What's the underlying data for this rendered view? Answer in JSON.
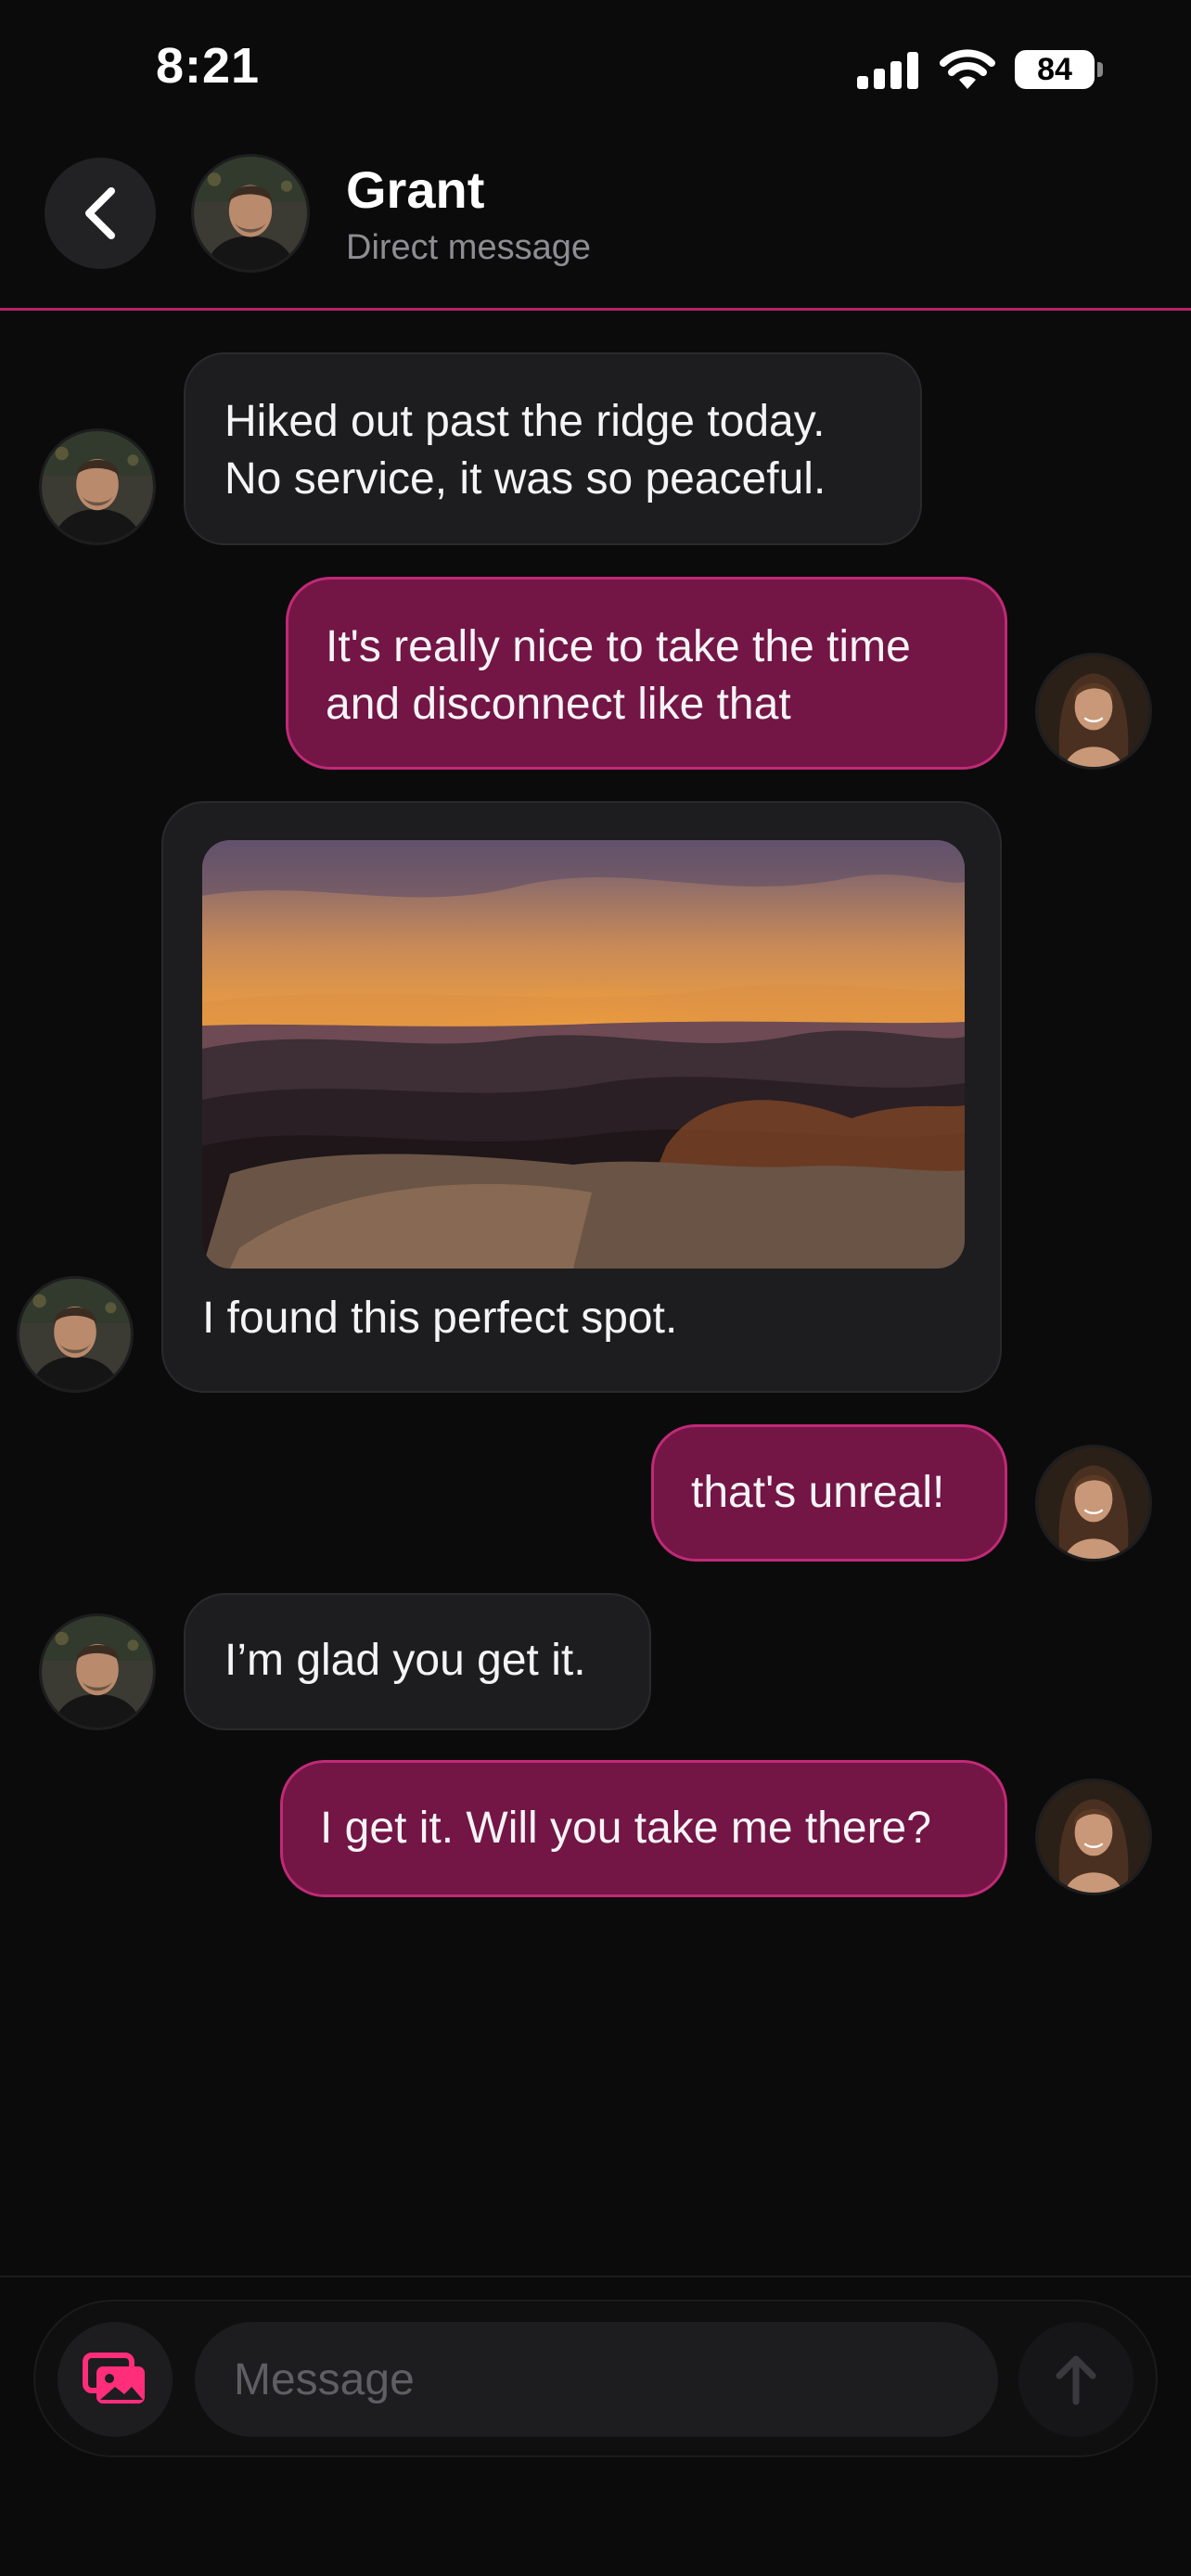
{
  "status_bar": {
    "time": "8:21",
    "battery": "84"
  },
  "header": {
    "name": "Grant",
    "subtitle": "Direct message"
  },
  "messages": [
    {
      "from": "them",
      "text": "Hiked out past the ridge today.\nNo service, it was so peaceful."
    },
    {
      "from": "me",
      "text": "It's really nice to take the time\nand disconnect like that"
    },
    {
      "from": "them",
      "caption": "I found this perfect spot."
    },
    {
      "from": "me",
      "text": "that's unreal!"
    },
    {
      "from": "them",
      "text": "I’m glad you get it."
    },
    {
      "from": "me",
      "text": "I get it. Will you take me there?"
    }
  ],
  "composer": {
    "placeholder": "Message"
  },
  "colors": {
    "accent": "#c02a77",
    "outgoing_bubble": "#731545",
    "incoming_bubble": "#1d1d1f",
    "background": "#0b0b0c",
    "media_icon": "#ff2d7a"
  },
  "icons": [
    "back-chevron-icon",
    "signal-icon",
    "wifi-icon",
    "battery-icon",
    "gallery-icon",
    "send-arrow-icon"
  ]
}
